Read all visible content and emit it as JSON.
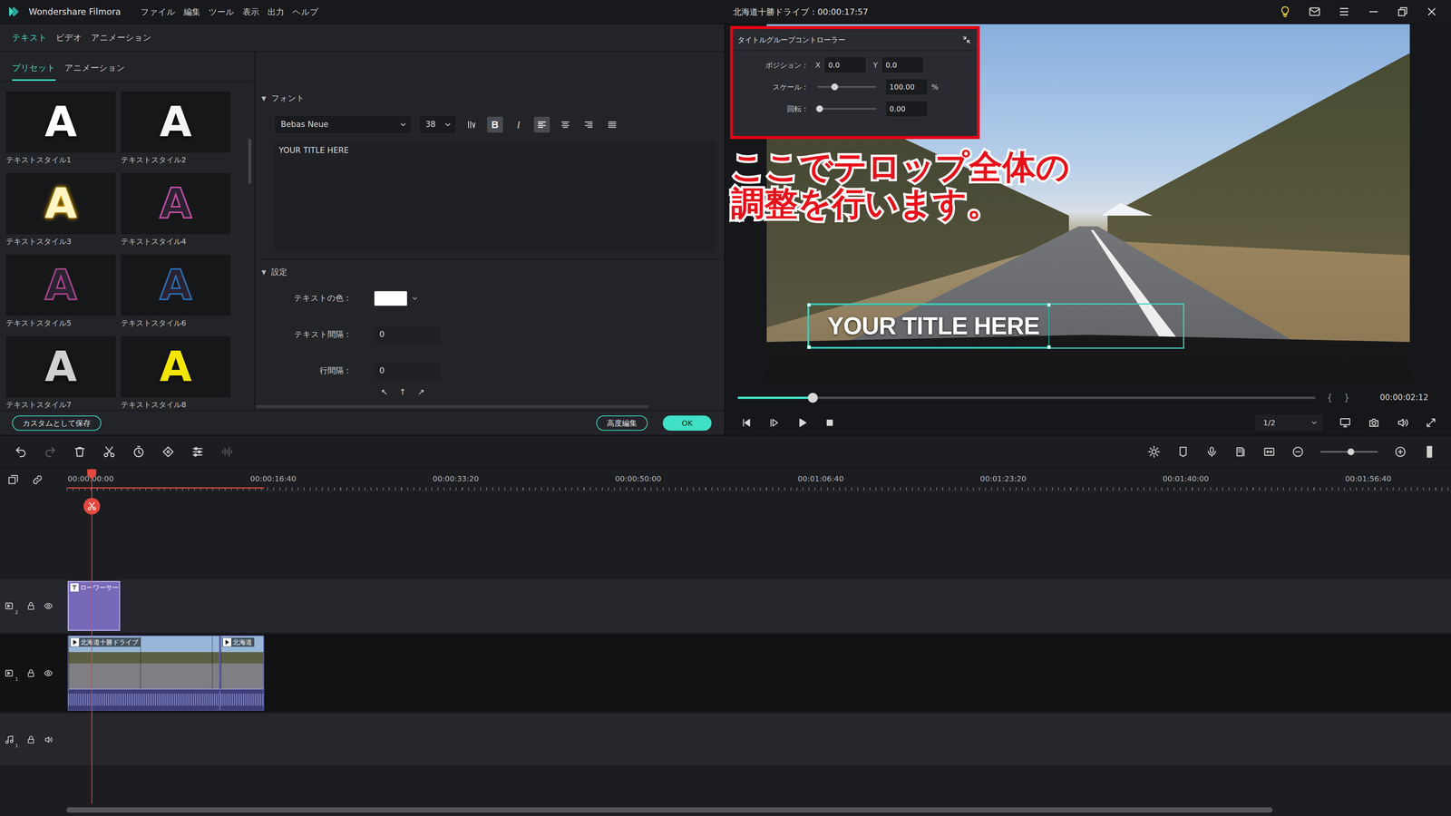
{
  "window": {
    "app_name": "Wondershare Filmora",
    "menu": [
      "ファイル",
      "編集",
      "ツール",
      "表示",
      "出力",
      "ヘルプ"
    ],
    "title": "北海道十勝ドライブ : 00:00:17:57"
  },
  "main_tabs": [
    {
      "label": "テキスト",
      "selected": true
    },
    {
      "label": "ビデオ",
      "selected": false
    },
    {
      "label": "アニメーション",
      "selected": false
    }
  ],
  "sub_tabs": [
    {
      "label": "プリセット",
      "selected": true
    },
    {
      "label": "アニメーション",
      "selected": false
    }
  ],
  "presets": [
    {
      "glyph": "A",
      "label": "テキストスタイル1",
      "kind": "solid",
      "color": "#ffffff"
    },
    {
      "glyph": "A",
      "label": "テキストスタイル2",
      "kind": "solid",
      "color": "#f4f4f4"
    },
    {
      "glyph": "A",
      "label": "テキストスタイル3",
      "kind": "glow",
      "color": "#fff6c4"
    },
    {
      "glyph": "A",
      "label": "テキストスタイル4",
      "kind": "outline",
      "color": "#c24fa6"
    },
    {
      "glyph": "A",
      "label": "テキストスタイル5",
      "kind": "outline",
      "color": "#a8458f"
    },
    {
      "glyph": "A",
      "label": "テキストスタイル6",
      "kind": "outline",
      "color": "#2a6fb5"
    },
    {
      "glyph": "A",
      "label": "テキストスタイル7",
      "kind": "solid",
      "color": "#d0d0d0"
    },
    {
      "glyph": "A",
      "label": "テキストスタイル8",
      "kind": "solid",
      "color": "#f2e600"
    }
  ],
  "editor": {
    "font_section": {
      "glyph": "▼",
      "label": "フォント"
    },
    "font_family": "Bebas Neue",
    "font_size": "38",
    "bold_glyph": "B",
    "bold": true,
    "italic_glyph": "I",
    "italic": false,
    "alignments": [
      {
        "kind": "left",
        "selected": true
      },
      {
        "kind": "center",
        "selected": false
      },
      {
        "kind": "right",
        "selected": false
      },
      {
        "kind": "justify",
        "selected": false
      }
    ],
    "text": "YOUR TITLE HERE",
    "settings_section": {
      "glyph": "▼",
      "label": "設定"
    },
    "settings": [
      {
        "kind": "color",
        "label": "テキストの色：",
        "color": "#ffffff"
      },
      {
        "kind": "number",
        "label": "テキスト間隔：",
        "value": "0"
      },
      {
        "kind": "number",
        "label": "行間隔：",
        "value": "0"
      }
    ],
    "position_arrows": [
      "↖",
      "↑",
      "↗"
    ]
  },
  "actions": {
    "save_custom": "カスタムとして保存",
    "advanced": "高度編集",
    "ok": "OK"
  },
  "controller": {
    "title": "タイトルグループコントローラー",
    "position_label": "ポジション：",
    "x_label": "X",
    "x": "0.0",
    "y_label": "Y",
    "y": "0.0",
    "scale_label": "スケール：",
    "scale": "100.00",
    "scale_unit": "%",
    "scale_level": 0.29,
    "rotation_label": "回転：",
    "rotation": "0.00",
    "rotation_level": 0.03
  },
  "annotation": {
    "lines": [
      "ここでテロップ全体の",
      "調整を行います。"
    ]
  },
  "preview": {
    "title_text": "YOUR TITLE HERE",
    "progress": 0.13,
    "mark_in": "{",
    "mark_out": "}",
    "timecode": "00:00:02:12",
    "quality": "1/2"
  },
  "timeline": {
    "toolbar": {
      "redo_disabled": true,
      "audio_disabled": true,
      "zoom_level": 0.53
    },
    "ruler": [
      "00:00:00:00",
      "00:00:16:40",
      "00:00:33:20",
      "00:00:50:00",
      "00:01:06:40",
      "00:01:23:20",
      "00:01:40:00",
      "00:01:56:40"
    ],
    "tick_seconds": 16.667,
    "playhead_seconds": 2.2,
    "work_area_end_seconds": 17.95,
    "tracks": [
      {
        "kind": "video",
        "number": "2",
        "locked": false,
        "visible": true,
        "clips": [
          {
            "kind": "title",
            "label": "ローワーサー",
            "start": 0,
            "end": 4.8
          }
        ]
      },
      {
        "kind": "video",
        "number": "1",
        "locked": false,
        "visible": true,
        "clips": [
          {
            "kind": "video",
            "label": "北海道十勝ドライブ",
            "start": 0,
            "end": 13.9
          },
          {
            "kind": "video",
            "label": "北海道",
            "start": 13.9,
            "end": 17.95
          }
        ]
      },
      {
        "kind": "audio",
        "number": "1",
        "locked": false,
        "visible": true,
        "clips": []
      }
    ]
  }
}
